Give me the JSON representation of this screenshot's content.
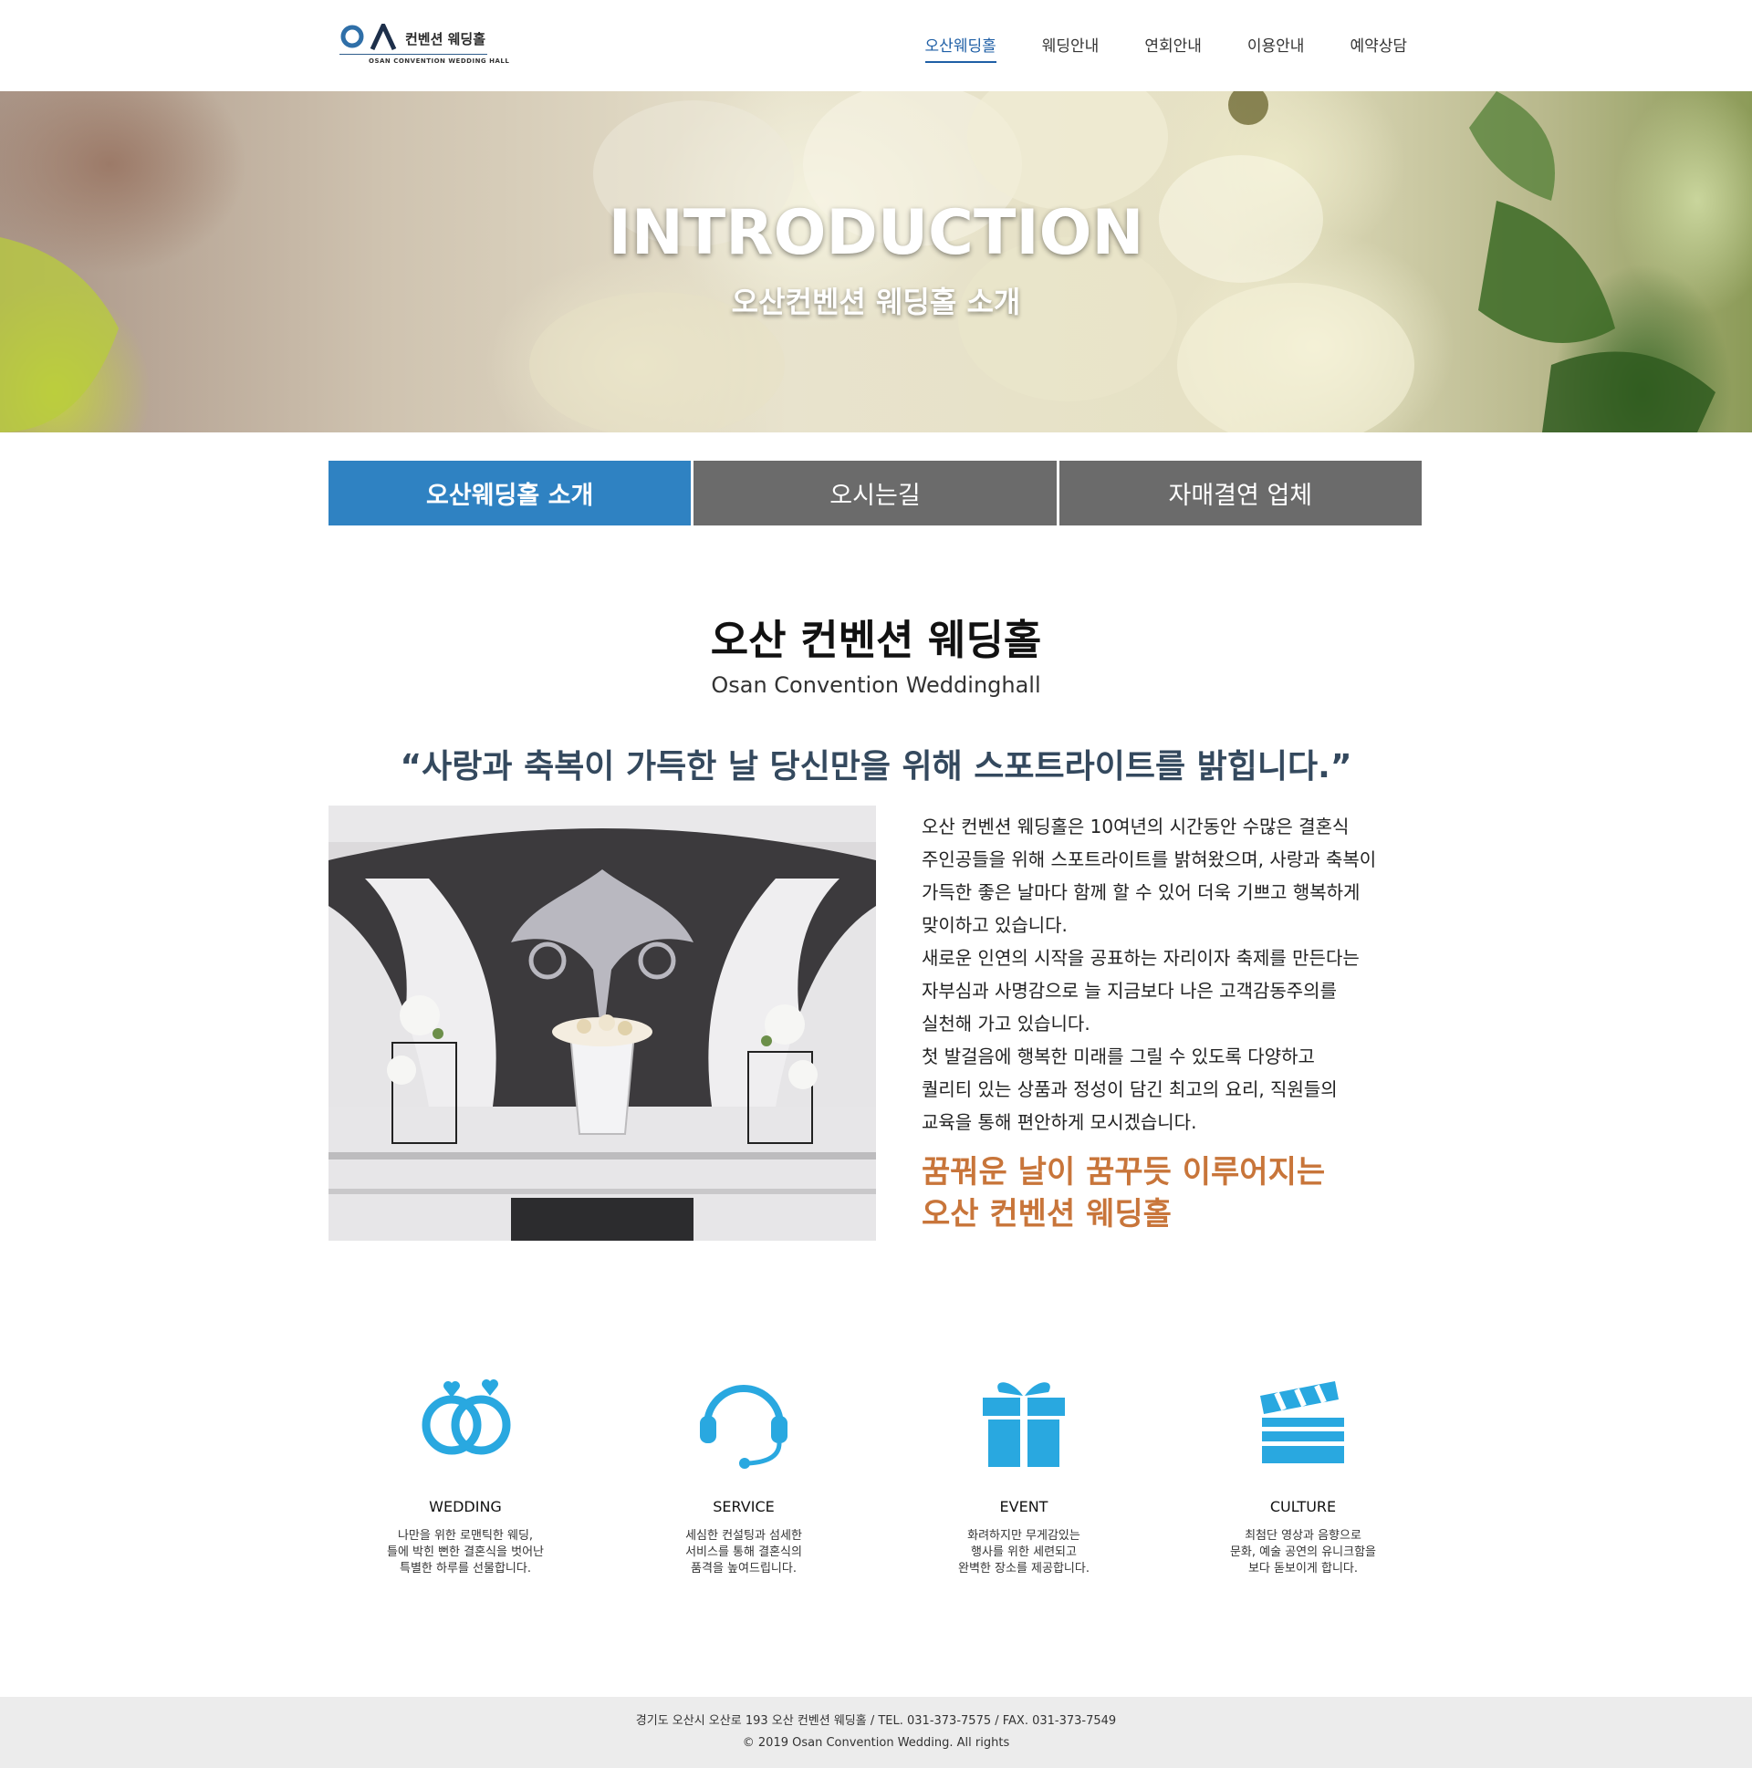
{
  "header": {
    "logo": {
      "mark": "OA",
      "korean": "컨벤션 웨딩홀",
      "english": "OSAN CONVENTION WEDDING HALL"
    },
    "nav": [
      {
        "label": "오산웨딩홀",
        "active": true
      },
      {
        "label": "웨딩안내",
        "active": false
      },
      {
        "label": "연회안내",
        "active": false
      },
      {
        "label": "이용안내",
        "active": false
      },
      {
        "label": "예약상담",
        "active": false
      }
    ]
  },
  "hero": {
    "title": "INTRODUCTION",
    "subtitle": "오산컨벤션 웨딩홀 소개"
  },
  "tabs": [
    {
      "label": "오산웨딩홀 소개",
      "active": true
    },
    {
      "label": "오시는길",
      "active": false
    },
    {
      "label": "자매결연 업체",
      "active": false
    }
  ],
  "intro": {
    "title": "오산 컨벤션 웨딩홀",
    "subtitle": "Osan Convention Weddinghall",
    "quote": "“사랑과 축복이 가득한 날 당신만을 위해 스포트라이트를 밝힙니다.”",
    "paragraph_lines": [
      "오산 컨벤션 웨딩홀은 10여년의 시간동안 수많은 결혼식",
      "주인공들을 위해 스포트라이트를 밝혀왔으며, 사랑과 축복이",
      "가득한 좋은 날마다 함께 할 수 있어 더욱 기쁘고 행복하게",
      "맞이하고 있습니다.",
      "새로운 인연의 시작을 공표하는 자리이자 축제를 만든다는",
      "자부심과 사명감으로 늘 지금보다 나은 고객감동주의를",
      "실천해 가고 있습니다.",
      "첫 발걸음에 행복한 미래를 그릴 수 있도록 다양하고",
      "퀄리티 있는 상품과 정성이 담긴 최고의 요리, 직원들의",
      "교육을 통해 편안하게 모시겠습니다."
    ],
    "slogan_lines": [
      "꿈꿔운 날이 꿈꾸듯 이루어지는",
      "오산 컨벤션 웨딩홀"
    ]
  },
  "features": [
    {
      "icon": "wedding-rings-icon",
      "title": "WEDDING",
      "lines": [
        "나만을 위한 로맨틱한 웨딩,",
        "틀에 박힌 뻔한 결혼식을 벗어난",
        "특별한 하루를 선물합니다."
      ]
    },
    {
      "icon": "headset-icon",
      "title": "SERVICE",
      "lines": [
        "세심한 컨설팅과 섬세한",
        "서비스를 통해 결혼식의",
        "품격을 높여드립니다."
      ]
    },
    {
      "icon": "gift-icon",
      "title": "EVENT",
      "lines": [
        "화려하지만 무게감있는",
        "행사를 위한 세련되고",
        "완벽한 장소를 제공합니다."
      ]
    },
    {
      "icon": "clapperboard-icon",
      "title": "CULTURE",
      "lines": [
        "최첨단 영상과 음향으로",
        "문화, 예술 공연의 유니크함을",
        "보다 돋보이게 합니다."
      ]
    }
  ],
  "footer": {
    "address": "경기도 오산시 오산로 193 오산 컨벤션 웨딩홀 / TEL. 031-373-7575 / FAX. 031-373-7549",
    "copyright": "© 2019 Osan Convention Wedding. All rights"
  },
  "colors": {
    "accent_blue": "#2f82c2",
    "nav_active": "#1f5fa6",
    "tab_inactive": "#6b6b6b",
    "quote": "#34495e",
    "slogan": "#c8753a",
    "icon": "#29a8e0",
    "footer_bg": "#ececec"
  }
}
